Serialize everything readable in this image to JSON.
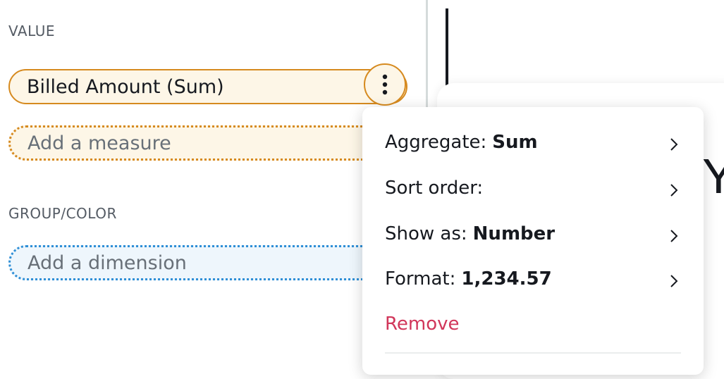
{
  "value_section": {
    "label": "VALUE",
    "field_label": "Billed Amount (Sum)",
    "add_placeholder": "Add a measure"
  },
  "group_section": {
    "label": "GROUP/COLOR",
    "add_placeholder": "Add a dimension"
  },
  "background_letter": "Y",
  "menu": {
    "aggregate": {
      "label": "Aggregate:",
      "value": "Sum"
    },
    "sort_order": {
      "label": "Sort order:",
      "value": ""
    },
    "show_as": {
      "label": "Show as:",
      "value": "Number"
    },
    "format": {
      "label": "Format:",
      "value": "1,234.57"
    },
    "remove": "Remove"
  },
  "colors": {
    "value_accent": "#d68a1f",
    "dimension_accent": "#2f8fd6",
    "danger": "#d1365a"
  },
  "icons": [
    "more-vertical-icon",
    "chevron-right-icon"
  ]
}
